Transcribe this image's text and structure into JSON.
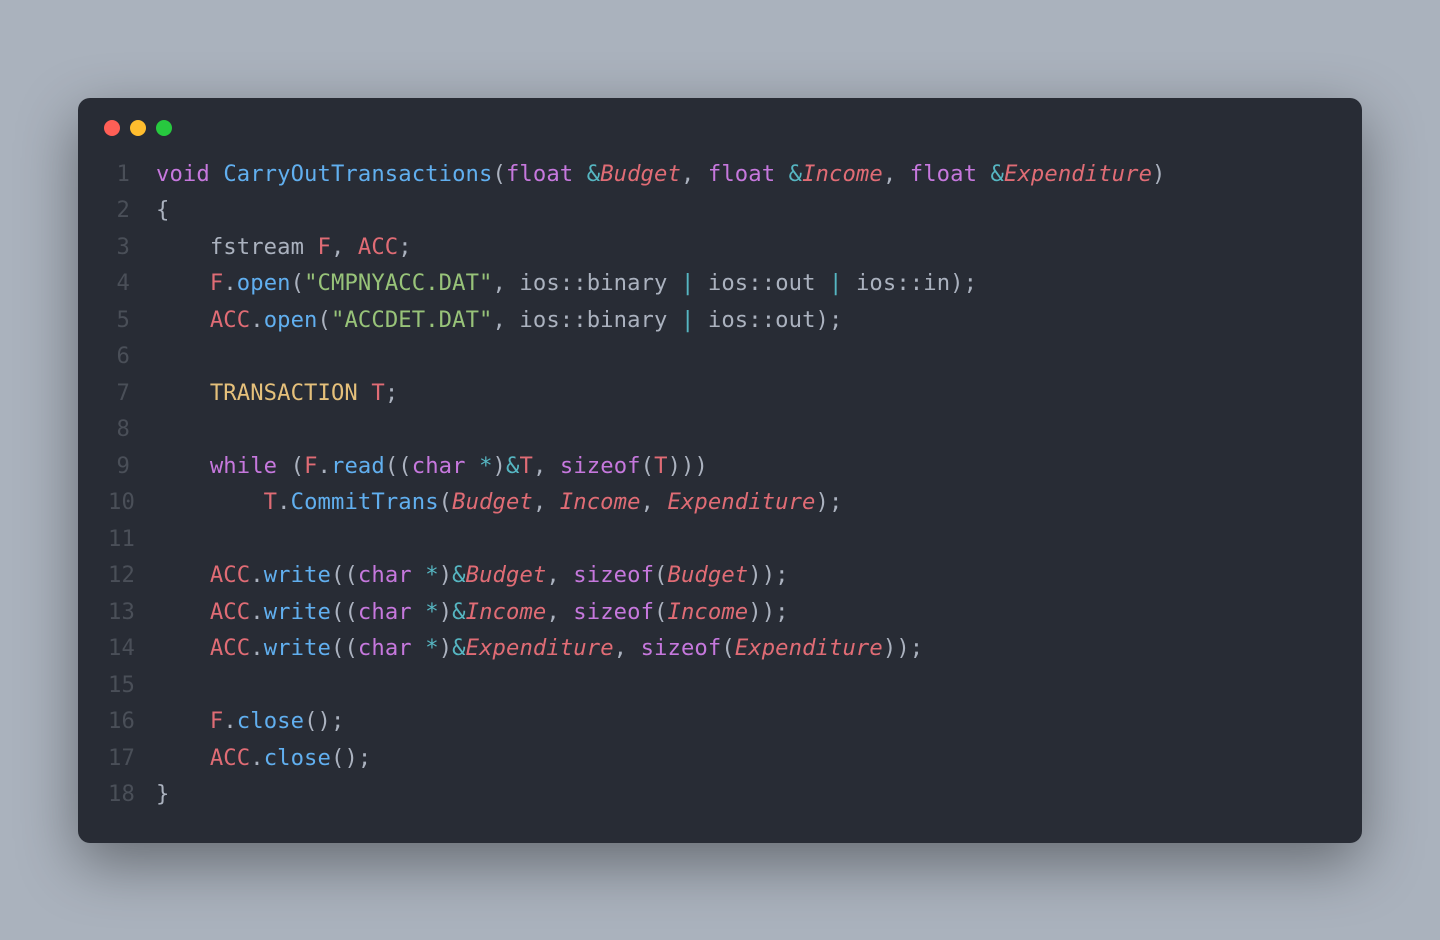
{
  "window": {
    "traffic_lights": [
      "close",
      "minimize",
      "maximize"
    ]
  },
  "editor": {
    "line_count": 18,
    "tokens": {
      "l1": [
        {
          "t": "kw",
          "v": "void"
        },
        {
          "t": "plain",
          "v": " "
        },
        {
          "t": "fn",
          "v": "CarryOutTransactions"
        },
        {
          "t": "plain",
          "v": "("
        },
        {
          "t": "type",
          "v": "float"
        },
        {
          "t": "plain",
          "v": " "
        },
        {
          "t": "op",
          "v": "&"
        },
        {
          "t": "param",
          "v": "Budget"
        },
        {
          "t": "plain",
          "v": ", "
        },
        {
          "t": "type",
          "v": "float"
        },
        {
          "t": "plain",
          "v": " "
        },
        {
          "t": "op",
          "v": "&"
        },
        {
          "t": "param",
          "v": "Income"
        },
        {
          "t": "plain",
          "v": ", "
        },
        {
          "t": "type",
          "v": "float"
        },
        {
          "t": "plain",
          "v": " "
        },
        {
          "t": "op",
          "v": "&"
        },
        {
          "t": "param",
          "v": "Expenditure"
        },
        {
          "t": "plain",
          "v": ")"
        }
      ],
      "l2": [
        {
          "t": "plain",
          "v": "{"
        }
      ],
      "l3": [
        {
          "t": "plain",
          "v": "    fstream "
        },
        {
          "t": "ident",
          "v": "F"
        },
        {
          "t": "plain",
          "v": ", "
        },
        {
          "t": "ident",
          "v": "ACC"
        },
        {
          "t": "plain",
          "v": ";"
        }
      ],
      "l4": [
        {
          "t": "plain",
          "v": "    "
        },
        {
          "t": "ident",
          "v": "F"
        },
        {
          "t": "plain",
          "v": "."
        },
        {
          "t": "fn",
          "v": "open"
        },
        {
          "t": "plain",
          "v": "("
        },
        {
          "t": "str",
          "v": "\"CMPNYACC.DAT\""
        },
        {
          "t": "plain",
          "v": ", ios"
        },
        {
          "t": "plain",
          "v": "::"
        },
        {
          "t": "plain",
          "v": "binary "
        },
        {
          "t": "op",
          "v": "|"
        },
        {
          "t": "plain",
          "v": " ios"
        },
        {
          "t": "plain",
          "v": "::"
        },
        {
          "t": "plain",
          "v": "out "
        },
        {
          "t": "op",
          "v": "|"
        },
        {
          "t": "plain",
          "v": " ios"
        },
        {
          "t": "plain",
          "v": "::"
        },
        {
          "t": "plain",
          "v": "in);"
        }
      ],
      "l5": [
        {
          "t": "plain",
          "v": "    "
        },
        {
          "t": "ident",
          "v": "ACC"
        },
        {
          "t": "plain",
          "v": "."
        },
        {
          "t": "fn",
          "v": "open"
        },
        {
          "t": "plain",
          "v": "("
        },
        {
          "t": "str",
          "v": "\"ACCDET.DAT\""
        },
        {
          "t": "plain",
          "v": ", ios"
        },
        {
          "t": "plain",
          "v": "::"
        },
        {
          "t": "plain",
          "v": "binary "
        },
        {
          "t": "op",
          "v": "|"
        },
        {
          "t": "plain",
          "v": " ios"
        },
        {
          "t": "plain",
          "v": "::"
        },
        {
          "t": "plain",
          "v": "out);"
        }
      ],
      "l6": [
        {
          "t": "plain",
          "v": ""
        }
      ],
      "l7": [
        {
          "t": "plain",
          "v": "    "
        },
        {
          "t": "cls",
          "v": "TRANSACTION"
        },
        {
          "t": "plain",
          "v": " "
        },
        {
          "t": "ident",
          "v": "T"
        },
        {
          "t": "plain",
          "v": ";"
        }
      ],
      "l8": [
        {
          "t": "plain",
          "v": ""
        }
      ],
      "l9": [
        {
          "t": "plain",
          "v": "    "
        },
        {
          "t": "kw",
          "v": "while"
        },
        {
          "t": "plain",
          "v": " ("
        },
        {
          "t": "ident",
          "v": "F"
        },
        {
          "t": "plain",
          "v": "."
        },
        {
          "t": "fn",
          "v": "read"
        },
        {
          "t": "plain",
          "v": "(("
        },
        {
          "t": "type",
          "v": "char"
        },
        {
          "t": "plain",
          "v": " "
        },
        {
          "t": "op",
          "v": "*"
        },
        {
          "t": "plain",
          "v": ")"
        },
        {
          "t": "op",
          "v": "&"
        },
        {
          "t": "ident",
          "v": "T"
        },
        {
          "t": "plain",
          "v": ", "
        },
        {
          "t": "kw",
          "v": "sizeof"
        },
        {
          "t": "plain",
          "v": "("
        },
        {
          "t": "ident",
          "v": "T"
        },
        {
          "t": "plain",
          "v": ")))"
        }
      ],
      "l10": [
        {
          "t": "plain",
          "v": "        "
        },
        {
          "t": "ident",
          "v": "T"
        },
        {
          "t": "plain",
          "v": "."
        },
        {
          "t": "fn",
          "v": "CommitTrans"
        },
        {
          "t": "plain",
          "v": "("
        },
        {
          "t": "param",
          "v": "Budget"
        },
        {
          "t": "plain",
          "v": ", "
        },
        {
          "t": "param",
          "v": "Income"
        },
        {
          "t": "plain",
          "v": ", "
        },
        {
          "t": "param",
          "v": "Expenditure"
        },
        {
          "t": "plain",
          "v": ");"
        }
      ],
      "l11": [
        {
          "t": "plain",
          "v": ""
        }
      ],
      "l12": [
        {
          "t": "plain",
          "v": "    "
        },
        {
          "t": "ident",
          "v": "ACC"
        },
        {
          "t": "plain",
          "v": "."
        },
        {
          "t": "fn",
          "v": "write"
        },
        {
          "t": "plain",
          "v": "(("
        },
        {
          "t": "type",
          "v": "char"
        },
        {
          "t": "plain",
          "v": " "
        },
        {
          "t": "op",
          "v": "*"
        },
        {
          "t": "plain",
          "v": ")"
        },
        {
          "t": "op",
          "v": "&"
        },
        {
          "t": "param",
          "v": "Budget"
        },
        {
          "t": "plain",
          "v": ", "
        },
        {
          "t": "kw",
          "v": "sizeof"
        },
        {
          "t": "plain",
          "v": "("
        },
        {
          "t": "param",
          "v": "Budget"
        },
        {
          "t": "plain",
          "v": "));"
        }
      ],
      "l13": [
        {
          "t": "plain",
          "v": "    "
        },
        {
          "t": "ident",
          "v": "ACC"
        },
        {
          "t": "plain",
          "v": "."
        },
        {
          "t": "fn",
          "v": "write"
        },
        {
          "t": "plain",
          "v": "(("
        },
        {
          "t": "type",
          "v": "char"
        },
        {
          "t": "plain",
          "v": " "
        },
        {
          "t": "op",
          "v": "*"
        },
        {
          "t": "plain",
          "v": ")"
        },
        {
          "t": "op",
          "v": "&"
        },
        {
          "t": "param",
          "v": "Income"
        },
        {
          "t": "plain",
          "v": ", "
        },
        {
          "t": "kw",
          "v": "sizeof"
        },
        {
          "t": "plain",
          "v": "("
        },
        {
          "t": "param",
          "v": "Income"
        },
        {
          "t": "plain",
          "v": "));"
        }
      ],
      "l14": [
        {
          "t": "plain",
          "v": "    "
        },
        {
          "t": "ident",
          "v": "ACC"
        },
        {
          "t": "plain",
          "v": "."
        },
        {
          "t": "fn",
          "v": "write"
        },
        {
          "t": "plain",
          "v": "(("
        },
        {
          "t": "type",
          "v": "char"
        },
        {
          "t": "plain",
          "v": " "
        },
        {
          "t": "op",
          "v": "*"
        },
        {
          "t": "plain",
          "v": ")"
        },
        {
          "t": "op",
          "v": "&"
        },
        {
          "t": "param",
          "v": "Expenditure"
        },
        {
          "t": "plain",
          "v": ", "
        },
        {
          "t": "kw",
          "v": "sizeof"
        },
        {
          "t": "plain",
          "v": "("
        },
        {
          "t": "param",
          "v": "Expenditure"
        },
        {
          "t": "plain",
          "v": "));"
        }
      ],
      "l15": [
        {
          "t": "plain",
          "v": ""
        }
      ],
      "l16": [
        {
          "t": "plain",
          "v": "    "
        },
        {
          "t": "ident",
          "v": "F"
        },
        {
          "t": "plain",
          "v": "."
        },
        {
          "t": "fn",
          "v": "close"
        },
        {
          "t": "plain",
          "v": "();"
        }
      ],
      "l17": [
        {
          "t": "plain",
          "v": "    "
        },
        {
          "t": "ident",
          "v": "ACC"
        },
        {
          "t": "plain",
          "v": "."
        },
        {
          "t": "fn",
          "v": "close"
        },
        {
          "t": "plain",
          "v": "();"
        }
      ],
      "l18": [
        {
          "t": "plain",
          "v": "}"
        }
      ]
    }
  }
}
